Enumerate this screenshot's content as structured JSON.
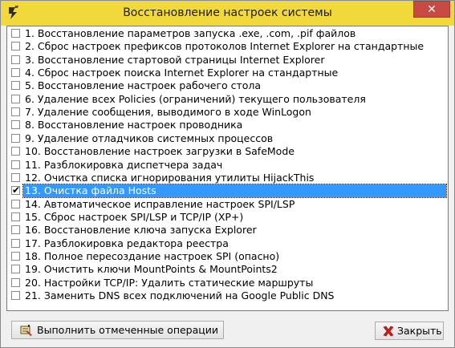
{
  "window": {
    "title": "Восстановление настроек системы",
    "close_glyph": "✕"
  },
  "list": {
    "items": [
      {
        "label": "1. Восстановление параметров запуска .exe, .com, .pif файлов",
        "checked": false,
        "selected": false
      },
      {
        "label": "2. Сброс настроек префиксов протоколов Internet Explorer на стандартные",
        "checked": false,
        "selected": false
      },
      {
        "label": "3. Восстановление стартовой страницы Internet Explorer",
        "checked": false,
        "selected": false
      },
      {
        "label": "4. Сброс настроек поиска Internet Explorer на стандартные",
        "checked": false,
        "selected": false
      },
      {
        "label": "5. Восстановление настроек рабочего стола",
        "checked": false,
        "selected": false
      },
      {
        "label": "6. Удаление всех Policies (ограничений) текущего пользователя",
        "checked": false,
        "selected": false
      },
      {
        "label": "7. Удаление сообщения, выводимого в ходе WinLogon",
        "checked": false,
        "selected": false
      },
      {
        "label": "8. Восстановление настроек проводника",
        "checked": false,
        "selected": false
      },
      {
        "label": "9. Удаление отладчиков системных процессов",
        "checked": false,
        "selected": false
      },
      {
        "label": "10. Восстановление настроек загрузки в SafeMode",
        "checked": false,
        "selected": false
      },
      {
        "label": "11. Разблокировка диспетчера задач",
        "checked": false,
        "selected": false
      },
      {
        "label": "12. Очистка списка игнорирования утилиты HijackThis",
        "checked": false,
        "selected": false
      },
      {
        "label": "13. Очистка файла Hosts",
        "checked": true,
        "selected": true
      },
      {
        "label": "14. Автоматическое исправление настроек SPI/LSP",
        "checked": false,
        "selected": false
      },
      {
        "label": "15. Сброс настроек SPI/LSP и TCP/IP (XP+)",
        "checked": false,
        "selected": false
      },
      {
        "label": "16. Восстановление ключа запуска Explorer",
        "checked": false,
        "selected": false
      },
      {
        "label": "17. Разблокировка редактора реестра",
        "checked": false,
        "selected": false
      },
      {
        "label": "18. Полное пересоздание настроек SPI (опасно)",
        "checked": false,
        "selected": false
      },
      {
        "label": "19. Очистить ключи MountPoints & MountPoints2",
        "checked": false,
        "selected": false
      },
      {
        "label": "20. Настройки TCP/IP: Удалить статические маршруты",
        "checked": false,
        "selected": false
      },
      {
        "label": "21. Заменить DNS всех подключений на Google Public DNS",
        "checked": false,
        "selected": false
      }
    ]
  },
  "buttons": {
    "run_label": "Выполнить отмеченные операции",
    "run_icon": "run-script-icon",
    "close_label": "Закрыть",
    "close_icon": "red-x-icon"
  },
  "colors": {
    "titlebar": "#f1d83b",
    "close_button": "#c74a43",
    "selection": "#3399ff"
  }
}
